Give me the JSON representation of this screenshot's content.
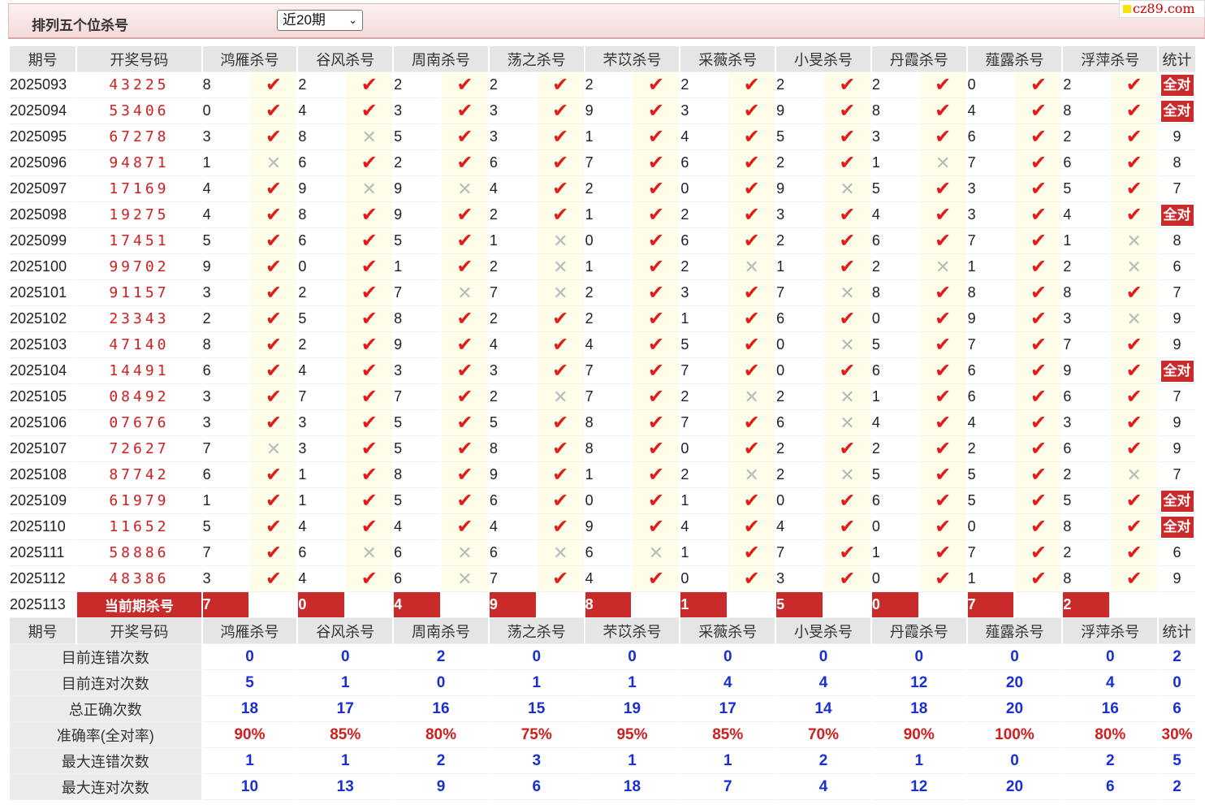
{
  "header": {
    "title": "排列五个位杀号",
    "period_select": "近20期",
    "logo": "cz89.com"
  },
  "columns": [
    "期号",
    "开奖号码",
    "鸿雁杀号",
    "谷风杀号",
    "周南杀号",
    "荡之杀号",
    "芣苡杀号",
    "采薇杀号",
    "小旻杀号",
    "丹霞杀号",
    "薤露杀号",
    "浮萍杀号",
    "统计"
  ],
  "rows": [
    {
      "issue": "2025093",
      "nums": "43225",
      "kills": [
        8,
        2,
        2,
        2,
        2,
        2,
        2,
        2,
        0,
        2
      ],
      "hits": [
        1,
        1,
        1,
        1,
        1,
        1,
        1,
        1,
        1,
        1
      ],
      "stat": "全对"
    },
    {
      "issue": "2025094",
      "nums": "53406",
      "kills": [
        0,
        4,
        3,
        3,
        9,
        3,
        9,
        8,
        4,
        8
      ],
      "hits": [
        1,
        1,
        1,
        1,
        1,
        1,
        1,
        1,
        1,
        1
      ],
      "stat": "全对"
    },
    {
      "issue": "2025095",
      "nums": "67278",
      "kills": [
        3,
        8,
        5,
        3,
        1,
        4,
        5,
        3,
        6,
        2
      ],
      "hits": [
        1,
        0,
        1,
        1,
        1,
        1,
        1,
        1,
        1,
        1
      ],
      "stat": "9"
    },
    {
      "issue": "2025096",
      "nums": "94871",
      "kills": [
        1,
        6,
        2,
        6,
        7,
        6,
        2,
        1,
        7,
        6
      ],
      "hits": [
        0,
        1,
        1,
        1,
        1,
        1,
        1,
        0,
        1,
        1
      ],
      "stat": "8"
    },
    {
      "issue": "2025097",
      "nums": "17169",
      "kills": [
        4,
        9,
        9,
        4,
        2,
        0,
        9,
        5,
        3,
        5
      ],
      "hits": [
        1,
        0,
        0,
        1,
        1,
        1,
        0,
        1,
        1,
        1
      ],
      "stat": "7"
    },
    {
      "issue": "2025098",
      "nums": "19275",
      "kills": [
        4,
        8,
        9,
        2,
        1,
        2,
        3,
        4,
        3,
        4
      ],
      "hits": [
        1,
        1,
        1,
        1,
        1,
        1,
        1,
        1,
        1,
        1
      ],
      "stat": "全对"
    },
    {
      "issue": "2025099",
      "nums": "17451",
      "kills": [
        5,
        6,
        5,
        1,
        0,
        6,
        2,
        6,
        7,
        1
      ],
      "hits": [
        1,
        1,
        1,
        0,
        1,
        1,
        1,
        1,
        1,
        0
      ],
      "stat": "8"
    },
    {
      "issue": "2025100",
      "nums": "99702",
      "kills": [
        9,
        0,
        1,
        2,
        1,
        2,
        1,
        2,
        1,
        2
      ],
      "hits": [
        1,
        1,
        1,
        0,
        1,
        0,
        1,
        0,
        1,
        0
      ],
      "stat": "6"
    },
    {
      "issue": "2025101",
      "nums": "91157",
      "kills": [
        3,
        2,
        7,
        7,
        2,
        3,
        7,
        8,
        8,
        8
      ],
      "hits": [
        1,
        1,
        0,
        0,
        1,
        1,
        0,
        1,
        1,
        1
      ],
      "stat": "7"
    },
    {
      "issue": "2025102",
      "nums": "23343",
      "kills": [
        2,
        5,
        8,
        2,
        2,
        1,
        6,
        0,
        9,
        3
      ],
      "hits": [
        1,
        1,
        1,
        1,
        1,
        1,
        1,
        1,
        1,
        0
      ],
      "stat": "9"
    },
    {
      "issue": "2025103",
      "nums": "47140",
      "kills": [
        8,
        2,
        9,
        4,
        4,
        5,
        0,
        5,
        7,
        7
      ],
      "hits": [
        1,
        1,
        1,
        1,
        1,
        1,
        0,
        1,
        1,
        1
      ],
      "stat": "9"
    },
    {
      "issue": "2025104",
      "nums": "14491",
      "kills": [
        6,
        4,
        3,
        3,
        7,
        7,
        0,
        6,
        6,
        9
      ],
      "hits": [
        1,
        1,
        1,
        1,
        1,
        1,
        1,
        1,
        1,
        1
      ],
      "stat": "全对"
    },
    {
      "issue": "2025105",
      "nums": "08492",
      "kills": [
        3,
        7,
        7,
        2,
        7,
        2,
        2,
        1,
        6,
        6
      ],
      "hits": [
        1,
        1,
        1,
        0,
        1,
        0,
        0,
        1,
        1,
        1
      ],
      "stat": "7"
    },
    {
      "issue": "2025106",
      "nums": "07676",
      "kills": [
        3,
        3,
        5,
        5,
        8,
        7,
        6,
        4,
        4,
        3
      ],
      "hits": [
        1,
        1,
        1,
        1,
        1,
        1,
        0,
        1,
        1,
        1
      ],
      "stat": "9"
    },
    {
      "issue": "2025107",
      "nums": "72627",
      "kills": [
        7,
        3,
        5,
        8,
        8,
        0,
        2,
        2,
        2,
        6
      ],
      "hits": [
        0,
        1,
        1,
        1,
        1,
        1,
        1,
        1,
        1,
        1
      ],
      "stat": "9"
    },
    {
      "issue": "2025108",
      "nums": "87742",
      "kills": [
        6,
        1,
        8,
        9,
        1,
        2,
        2,
        5,
        5,
        2
      ],
      "hits": [
        1,
        1,
        1,
        1,
        1,
        0,
        0,
        1,
        1,
        0
      ],
      "stat": "7"
    },
    {
      "issue": "2025109",
      "nums": "61979",
      "kills": [
        1,
        1,
        5,
        6,
        0,
        1,
        0,
        6,
        5,
        5
      ],
      "hits": [
        1,
        1,
        1,
        1,
        1,
        1,
        1,
        1,
        1,
        1
      ],
      "stat": "全对"
    },
    {
      "issue": "2025110",
      "nums": "11652",
      "kills": [
        5,
        4,
        4,
        4,
        9,
        4,
        4,
        0,
        0,
        8
      ],
      "hits": [
        1,
        1,
        1,
        1,
        1,
        1,
        1,
        1,
        1,
        1
      ],
      "stat": "全对"
    },
    {
      "issue": "2025111",
      "nums": "58886",
      "kills": [
        7,
        6,
        6,
        6,
        6,
        1,
        7,
        1,
        7,
        2
      ],
      "hits": [
        1,
        0,
        0,
        0,
        0,
        1,
        1,
        1,
        1,
        1
      ],
      "stat": "6"
    },
    {
      "issue": "2025112",
      "nums": "48386",
      "kills": [
        3,
        4,
        6,
        7,
        4,
        0,
        3,
        0,
        1,
        8
      ],
      "hits": [
        1,
        1,
        0,
        1,
        1,
        1,
        1,
        1,
        1,
        1
      ],
      "stat": "9"
    }
  ],
  "current": {
    "issue": "2025113",
    "label": "当前期杀号",
    "kills": [
      7,
      0,
      4,
      9,
      8,
      1,
      5,
      0,
      7,
      2
    ]
  },
  "summary": [
    {
      "label": "目前连错次数",
      "values": [
        "0",
        "0",
        "2",
        "0",
        "0",
        "0",
        "0",
        "0",
        "0",
        "0",
        "2"
      ],
      "red": false
    },
    {
      "label": "目前连对次数",
      "values": [
        "5",
        "1",
        "0",
        "1",
        "1",
        "4",
        "4",
        "12",
        "20",
        "4",
        "0"
      ],
      "red": false
    },
    {
      "label": "总正确次数",
      "values": [
        "18",
        "17",
        "16",
        "15",
        "19",
        "17",
        "14",
        "18",
        "20",
        "16",
        "6"
      ],
      "red": false
    },
    {
      "label": "准确率(全对率)",
      "values": [
        "90%",
        "85%",
        "80%",
        "75%",
        "95%",
        "85%",
        "70%",
        "90%",
        "100%",
        "80%",
        "30%"
      ],
      "red": true
    },
    {
      "label": "最大连错次数",
      "values": [
        "1",
        "1",
        "2",
        "3",
        "1",
        "1",
        "2",
        "1",
        "0",
        "2",
        "5"
      ],
      "red": false
    },
    {
      "label": "最大连对次数",
      "values": [
        "10",
        "13",
        "9",
        "6",
        "18",
        "7",
        "4",
        "12",
        "20",
        "6",
        "2"
      ],
      "red": false
    }
  ],
  "icons": {
    "hit": "check-icon",
    "miss": "cross-icon"
  },
  "colors": {
    "accent_red": "#c92a2a",
    "blue": "#1a2fd0",
    "mark_bg": "#fdfdea"
  }
}
